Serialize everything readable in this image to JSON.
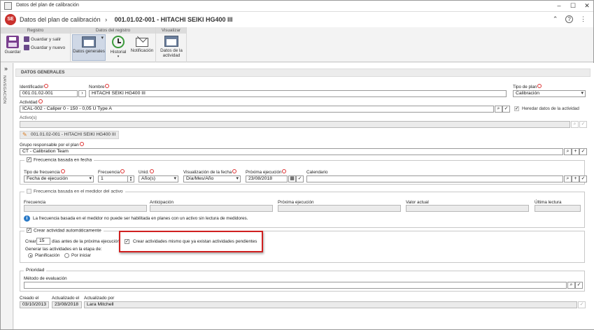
{
  "window": {
    "title": "Datos del plan de calibración"
  },
  "header": {
    "prefix": "Datos del plan de calibración",
    "arrow": "›",
    "code": "001.01.02-001 - HITACHI SEIKI HG400 III",
    "logo_text": "SE"
  },
  "ribbon": {
    "groups": {
      "registro": "Registro",
      "datos": "Datos del registro",
      "visualizar": "Visualizar"
    },
    "guardar": "Guardar",
    "guardar_salir": "Guardar y salir",
    "guardar_nuevo": "Guardar y nuevo",
    "datos_generales": "Datos generales",
    "historial": "Historial",
    "notificacion": "Notificación",
    "datos_actividad_1": "Datos de la",
    "datos_actividad_2": "actividad"
  },
  "nav": {
    "label": "NAVEGACIÓN",
    "toggle": "»"
  },
  "section": {
    "title": "DATOS GENERALES"
  },
  "form": {
    "identificador_label": "Identificador",
    "identificador": "001.01.02-001",
    "nombre_label": "Nombre",
    "nombre": "HITACHI SEIKI HG400 III",
    "tipo_plan_label": "Tipo de plan",
    "tipo_plan": "Calibración",
    "actividad_label": "Actividad",
    "actividad": "ICAL-002 - Caliper 0 - 150 - 0,05 U Type A",
    "heredar_label": "Heredar datos de la actividad",
    "activos_label": "Activo(s)",
    "chip": "001.01.02-001 - HITACHI SEIKI HG400 III",
    "grupo_label": "Grupo responsable por el plan",
    "grupo": "CT - Calibration Team"
  },
  "fecha": {
    "header": "Frecuencia basada en fecha",
    "tipo_label": "Tipo de frecuencia",
    "tipo": "Fecha de ejecución",
    "frecuencia_label": "Frecuencia",
    "frecuencia": "1",
    "unid_label": "Unid.",
    "unid": "Año(s)",
    "visualizacion_label": "Visualización de la fecha",
    "visualizacion": "Día/Mes/Año",
    "proxima_label": "Próxima ejecución",
    "proxima": "23/08/2018",
    "calendario_label": "Calendario"
  },
  "medidor": {
    "header": "Frecuencia basada en el medidor del activo",
    "cols": [
      "Frecuencia",
      "Anticipación",
      "Próxima ejecución",
      "Valor actual",
      "Última lectura"
    ],
    "info": "La frecuencia basada en el medidor no puede ser habilitada en planes con un activo sin lectura de medidores."
  },
  "crear": {
    "header": "Crear actividad automáticamente",
    "crear_label": "Crear",
    "dias": "15",
    "dias_suffix": "días antes de la próxima ejecución",
    "etapa_label": "Generar las actividades en la etapa de:",
    "planificacion": "Planificación",
    "por_iniciar": "Por iniciar",
    "pendientes": "Crear actividades mismo que ya existan actividades pendientes"
  },
  "prioridad": {
    "header": "Prioridad",
    "metodo_label": "Método de evaluación"
  },
  "footer": {
    "creado_label": "Creado el",
    "creado": "03/10/2013",
    "actualizado_label": "Actualizado el",
    "actualizado": "23/08/2018",
    "por_label": "Actualizado por",
    "por": "Lara Mitchell"
  }
}
